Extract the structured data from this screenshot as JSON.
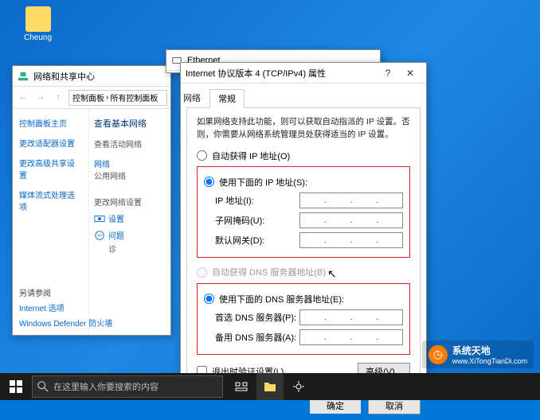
{
  "desktop": {
    "icon_label": "Cheung"
  },
  "net_center": {
    "title": "网络和共享中心",
    "breadcrumb": {
      "a": "控制面板",
      "b": "所有控制面板"
    },
    "left": {
      "home": "控制面板主页",
      "adapter": "更改适配器设置",
      "sharing": "更改高级共享设置",
      "media": "媒体流式处理选项"
    },
    "main": {
      "heading": "查看基本网络",
      "active": "查看活动网络",
      "netname": "网络",
      "nettype": "公用网络",
      "change_heading": "更改网络设置",
      "setup_link": "设置",
      "diag_link": "问题",
      "diag_prefix": "诊"
    },
    "seealso": {
      "heading": "另请参阅",
      "internet": "Internet 选项",
      "defender": "Windows Defender 防火墙"
    }
  },
  "ethernet": {
    "title": "Ethernet"
  },
  "ipv4": {
    "title": "Internet 协议版本 4 (TCP/IPv4) 属性",
    "tab_general": "常规",
    "partial_tab": "网络",
    "desc": "如果网络支持此功能，则可以获取自动指派的 IP 设置。否则，你需要从网络系统管理员处获得适当的 IP 设置。",
    "radio_auto_ip": "自动获得 IP 地址(O)",
    "radio_manual_ip": "使用下面的 IP 地址(S):",
    "ip_label": "IP 地址(I):",
    "subnet_label": "子网掩码(U):",
    "gateway_label": "默认网关(D):",
    "radio_auto_dns": "自动获得 DNS 服务器地址(B)",
    "radio_manual_dns": "使用下面的 DNS 服务器地址(E):",
    "dns1_label": "首选 DNS 服务器(P):",
    "dns2_label": "备用 DNS 服务器(A):",
    "validate": "退出时验证设置(L)",
    "advanced": "高级(V)...",
    "ok": "确定",
    "cancel": "取消",
    "ip_selected": "manual",
    "dns_selected": "manual"
  },
  "taskbar": {
    "search_placeholder": "在这里输入你要搜索的内容"
  },
  "watermark": {
    "text": "系统天地",
    "url": "www.XiTongTianDi.com"
  }
}
